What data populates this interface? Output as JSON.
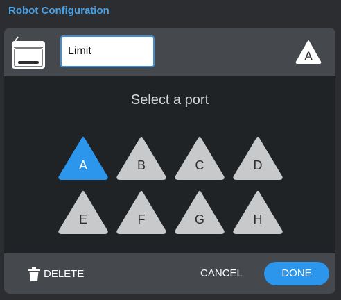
{
  "window": {
    "title": "Robot Configuration"
  },
  "header": {
    "device_icon": "robot-brain-icon",
    "name_value": "Limit",
    "name_placeholder": "",
    "current_port": "A"
  },
  "prompt": "Select a port",
  "ports": [
    {
      "label": "A",
      "selected": true
    },
    {
      "label": "B",
      "selected": false
    },
    {
      "label": "C",
      "selected": false
    },
    {
      "label": "D",
      "selected": false
    },
    {
      "label": "E",
      "selected": false
    },
    {
      "label": "F",
      "selected": false
    },
    {
      "label": "G",
      "selected": false
    },
    {
      "label": "H",
      "selected": false
    }
  ],
  "footer": {
    "delete_label": "DELETE",
    "delete_icon": "trash-icon",
    "cancel_label": "CANCEL",
    "done_label": "DONE"
  },
  "colors": {
    "accent": "#2b96ec",
    "title": "#4aa3e8",
    "port_unselected": "#c8c9ca",
    "panel": "#45494e",
    "body": "#202326"
  }
}
